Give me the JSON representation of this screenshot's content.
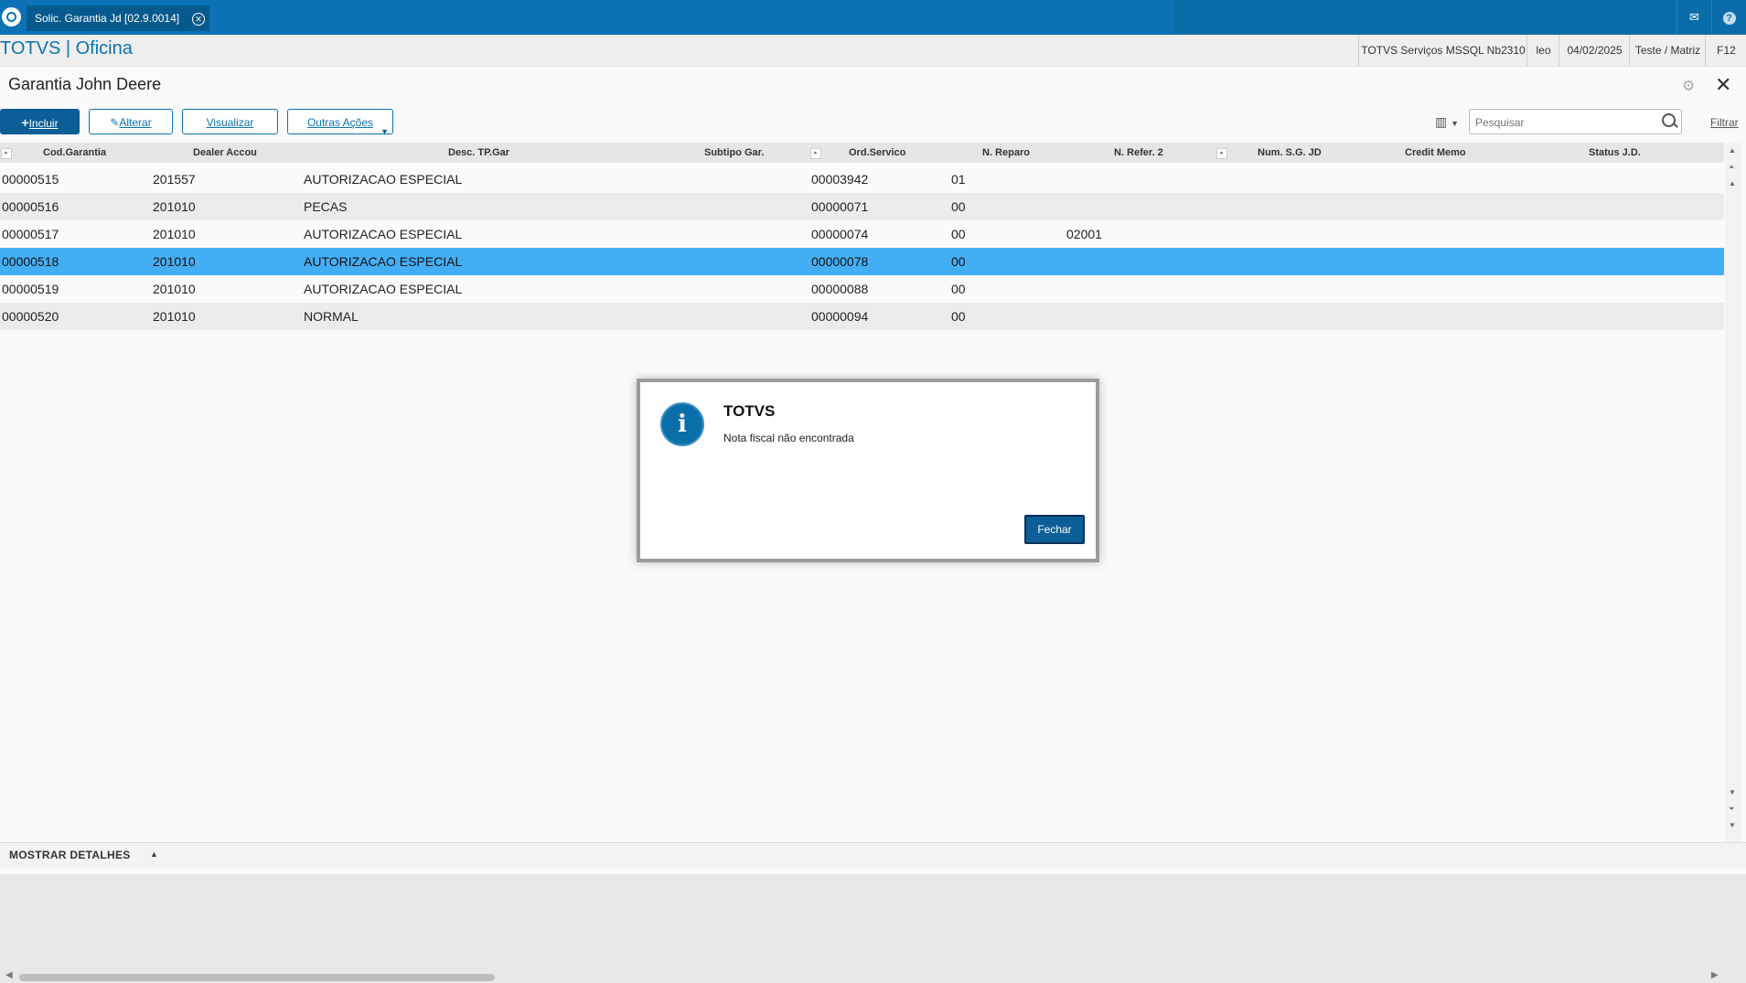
{
  "topbar": {
    "tab_label": "Solic. Garantia Jd [02.9.0014]",
    "tab_close": "✕",
    "mail_glyph": "✉",
    "help_glyph": "?"
  },
  "infobar": {
    "brand": "TOTVS | Oficina",
    "server": "TOTVS Serviços MSSQL Nb2310",
    "user": "leo",
    "date": "04/02/2025",
    "branch": "Teste / Matriz",
    "shortcut": "F12"
  },
  "page": {
    "title": "Garantia John Deere",
    "close_glyph": "✕",
    "gear_glyph": "⚙"
  },
  "toolbar": {
    "incluir": "Incluir",
    "alterar": "Alterar",
    "visualizar": "Visualizar",
    "outras_acoes": "Outras Ações",
    "search_placeholder": "Pesquisar",
    "filtrar": "Filtrar"
  },
  "grid": {
    "headers": [
      "Cod.Garantia",
      "Dealer Accou",
      "Desc. TP.Gar",
      "Subtipo Gar.",
      "Ord.Servico",
      "N. Reparo",
      "N. Refer. 2",
      "Num. S.G. JD",
      "Credit Memo",
      "Status J.D."
    ],
    "rows": [
      [
        "00000515",
        "201557",
        "AUTORIZACAO ESPECIAL",
        "",
        "00003942",
        "01",
        ""
      ],
      [
        "00000516",
        "201010",
        "PECAS",
        "",
        "00000071",
        "00",
        ""
      ],
      [
        "00000517",
        "201010",
        "AUTORIZACAO ESPECIAL",
        "",
        "00000074",
        "00",
        "02001"
      ],
      [
        "00000518",
        "201010",
        "AUTORIZACAO ESPECIAL",
        "",
        "00000078",
        "00",
        ""
      ],
      [
        "00000519",
        "201010",
        "AUTORIZACAO ESPECIAL",
        "",
        "00000088",
        "00",
        ""
      ],
      [
        "00000520",
        "201010",
        "NORMAL",
        "",
        "00000094",
        "00",
        ""
      ]
    ],
    "selected_row": 3
  },
  "footer": {
    "label": "MOSTRAR DETALHES"
  },
  "modal": {
    "icon": "i",
    "title": "TOTVS",
    "message": "Nota fiscal não encontrada",
    "button": "Fechar"
  },
  "colors": {
    "accent": "#0b72b5",
    "selected_row": "#44aef5",
    "primary_button": "#0b5e96"
  }
}
